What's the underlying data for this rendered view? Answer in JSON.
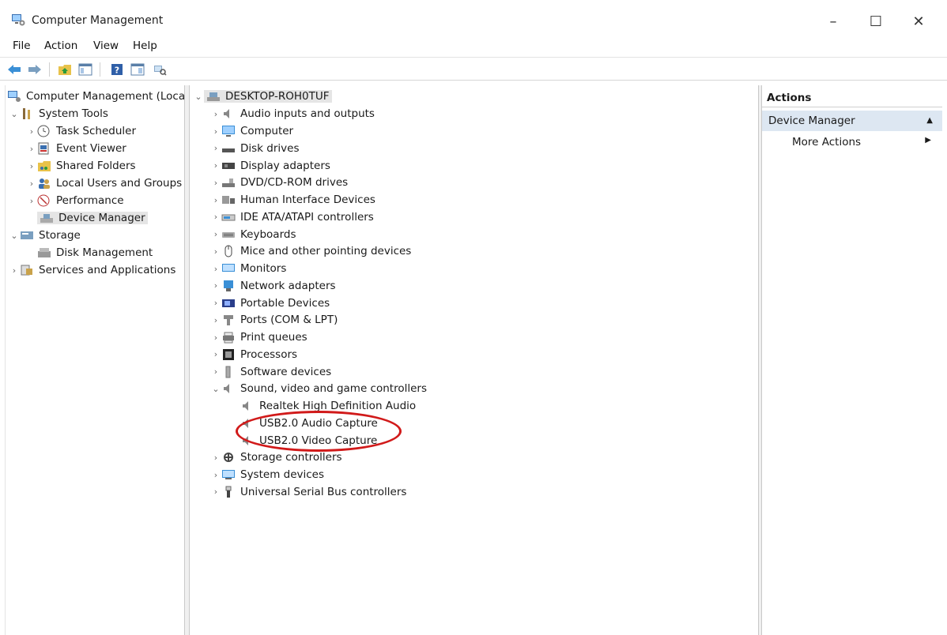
{
  "window": {
    "title": "Computer Management",
    "minimize": "–",
    "maximize": "☐",
    "close": "✕"
  },
  "menu": [
    "File",
    "Action",
    "View",
    "Help"
  ],
  "left_tree": {
    "root": "Computer Management (Local",
    "system_tools": "System Tools",
    "items": [
      "Task Scheduler",
      "Event Viewer",
      "Shared Folders",
      "Local Users and Groups",
      "Performance",
      "Device Manager"
    ],
    "storage": "Storage",
    "disk_management": "Disk Management",
    "services": "Services and Applications"
  },
  "device_tree": {
    "root": "DESKTOP-ROH0TUF",
    "categories": [
      "Audio inputs and outputs",
      "Computer",
      "Disk drives",
      "Display adapters",
      "DVD/CD-ROM drives",
      "Human Interface Devices",
      "IDE ATA/ATAPI controllers",
      "Keyboards",
      "Mice and other pointing devices",
      "Monitors",
      "Network adapters",
      "Portable Devices",
      "Ports (COM & LPT)",
      "Print queues",
      "Processors",
      "Software devices",
      "Sound, video and game controllers"
    ],
    "sound_children": [
      "Realtek High Definition Audio",
      "USB2.0 Audio Capture",
      "USB2.0 Video Capture"
    ],
    "after_categories": [
      "Storage controllers",
      "System devices",
      "Universal Serial Bus controllers"
    ]
  },
  "actions": {
    "header": "Actions",
    "section": "Device Manager",
    "more": "More Actions"
  },
  "colors": {
    "selection": "#e5e5e5",
    "actions_section": "#dde7f2",
    "highlight": "#d11a1a"
  }
}
